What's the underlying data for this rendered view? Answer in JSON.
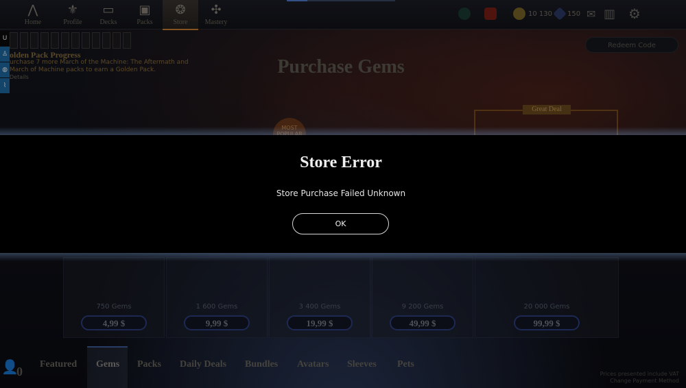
{
  "nav": {
    "items": [
      {
        "label": "Home",
        "icon": "planeswalker-icon"
      },
      {
        "label": "Profile",
        "icon": "profile-icon"
      },
      {
        "label": "Decks",
        "icon": "decks-icon"
      },
      {
        "label": "Packs",
        "icon": "packs-icon"
      },
      {
        "label": "Store",
        "icon": "store-icon"
      },
      {
        "label": "Mastery",
        "icon": "mastery-icon"
      }
    ],
    "active": "Store"
  },
  "currency": {
    "gold": "10 130",
    "gems": "150"
  },
  "golden_pack": {
    "title": "olden Pack Progress",
    "description": "urchase 7 more March of the Machine: The Aftermath and March of Machine packs to earn a Golden Pack.",
    "details": "Details"
  },
  "store": {
    "page_title": "Purchase Gems",
    "redeem_label": "Redeem Code",
    "great_deal": "Great Deal",
    "most_popular": "MOST POPULAR",
    "cards": [
      {
        "gems": "750 Gems",
        "price": "4,99 $"
      },
      {
        "gems": "1 600 Gems",
        "price": "9,99 $"
      },
      {
        "gems": "3 400 Gems",
        "price": "19,99 $"
      },
      {
        "gems": "9 200 Gems",
        "price": "49,99 $"
      },
      {
        "gems": "20 000 Gems",
        "price": "99,99 $"
      }
    ]
  },
  "bottom_tabs": [
    "Featured",
    "Gems",
    "Packs",
    "Daily Deals",
    "Bundles",
    "Avatars",
    "Sleeves",
    "Pets"
  ],
  "friends_count": "0",
  "price_note": [
    "Prices presented include VAT",
    "Change Payment Method"
  ],
  "modal": {
    "title": "Store Error",
    "message": "Store Purchase Failed Unknown",
    "ok_label": "OK"
  }
}
